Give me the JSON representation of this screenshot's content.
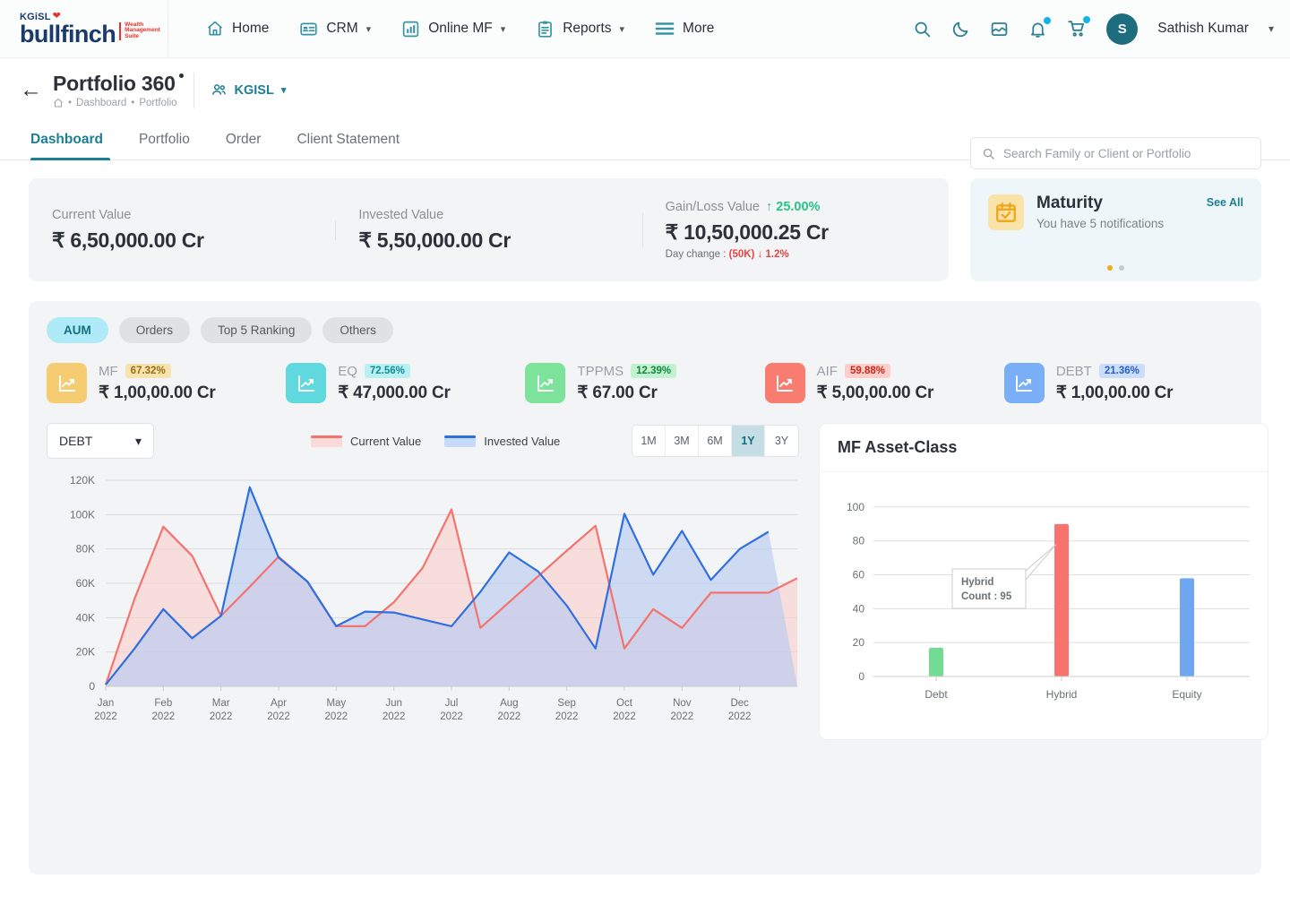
{
  "brand": {
    "kgisl": "KGiSL",
    "name": "bullfinch",
    "tag1": "Wealth",
    "tag2": "Management",
    "tag3": "Suite"
  },
  "topnav": {
    "items": [
      {
        "label": "Home",
        "icon": "home-icon",
        "caret": false
      },
      {
        "label": "CRM",
        "icon": "crm-card-icon",
        "caret": true
      },
      {
        "label": "Online MF",
        "icon": "bar-chart-icon",
        "caret": true
      },
      {
        "label": "Reports",
        "icon": "clipboard-icon",
        "caret": true
      },
      {
        "label": "More",
        "icon": "hamburger-icon",
        "caret": false
      }
    ],
    "icons": [
      "search-icon",
      "moon-icon",
      "inbox-icon",
      "bell-icon",
      "cart-icon"
    ],
    "user": {
      "initial": "S",
      "name": "Sathish Kumar"
    }
  },
  "pagehead": {
    "back": "←",
    "title": "Portfolio 360",
    "breadcrumb": [
      "Dashboard",
      "Portfolio"
    ],
    "org": "KGISL"
  },
  "search": {
    "placeholder": "Search Family or Client or Portfolio",
    "value": ""
  },
  "tabs": [
    {
      "label": "Dashboard",
      "active": true
    },
    {
      "label": "Portfolio",
      "active": false
    },
    {
      "label": "Order",
      "active": false
    },
    {
      "label": "Client Statement",
      "active": false
    }
  ],
  "summary": {
    "current": {
      "label": "Current Value",
      "value": "₹ 6,50,000.00 Cr"
    },
    "invested": {
      "label": "Invested Value",
      "value": "₹ 5,50,000.00 Cr"
    },
    "gainloss": {
      "label": "Gain/Loss Value",
      "pct": "↑ 25.00%",
      "value": "₹ 10,50,000.25 Cr",
      "daychange_label": "Day change :",
      "daychange_value": "(50K)",
      "daychange_pct": "↓ 1.2%"
    }
  },
  "maturity": {
    "title": "Maturity",
    "subtitle": "You have 5 notifications",
    "see_all": "See All",
    "icon": "calendar-check-icon",
    "dots": 2,
    "active_dot": 0
  },
  "chips": [
    {
      "label": "AUM",
      "active": true
    },
    {
      "label": "Orders",
      "active": false
    },
    {
      "label": "Top 5 Ranking",
      "active": false
    },
    {
      "label": "Others",
      "active": false
    }
  ],
  "metrics": [
    {
      "name": "MF",
      "pct": "67.32%",
      "value": "₹ 1,00,00.00 Cr",
      "tile": "#f6cc73",
      "pct_bg": "#f7e3b0",
      "pct_fg": "#9a6f0d"
    },
    {
      "name": "EQ",
      "pct": "72.56%",
      "value": "₹ 47,000.00 Cr",
      "tile": "#5fd9dd",
      "pct_bg": "#b9f1f3",
      "pct_fg": "#0f8e96"
    },
    {
      "name": "TPPMS",
      "pct": "12.39%",
      "value": "₹ 67.00 Cr",
      "tile": "#7ee39a",
      "pct_bg": "#c3f2d1",
      "pct_fg": "#0f8a3c"
    },
    {
      "name": "AIF",
      "pct": "59.88%",
      "value": "₹ 5,00,00.00 Cr",
      "tile": "#f97c70",
      "pct_bg": "#fccfcb",
      "pct_fg": "#cc2418"
    },
    {
      "name": "DEBT",
      "pct": "21.36%",
      "value": "₹ 1,00,00.00 Cr",
      "tile": "#7aaef7",
      "pct_bg": "#ccddfb",
      "pct_fg": "#2460c4"
    }
  ],
  "chart_controls": {
    "select_value": "DEBT",
    "legend": [
      {
        "label": "Current Value",
        "color": "#f4736f"
      },
      {
        "label": "Invested Value",
        "color": "#2f6fe0"
      }
    ],
    "ranges": [
      {
        "label": "1M",
        "active": false
      },
      {
        "label": "3M",
        "active": false
      },
      {
        "label": "6M",
        "active": false
      },
      {
        "label": "1Y",
        "active": true
      },
      {
        "label": "3Y",
        "active": false
      }
    ]
  },
  "chart_data": [
    {
      "type": "area",
      "title": "",
      "xlabel": "",
      "ylabel": "",
      "ylim": [
        0,
        120000
      ],
      "yticks": [
        0,
        20000,
        40000,
        60000,
        80000,
        100000,
        120000
      ],
      "yticklabels": [
        "0",
        "20K",
        "40K",
        "60K",
        "80K",
        "100K",
        "120K"
      ],
      "grid": true,
      "legend_position": "top-center",
      "categories": [
        "Jan 2022",
        "Feb 2022",
        "Mar 2022",
        "Apr 2022",
        "May 2022",
        "Jun 2022",
        "Jul 2022",
        "Aug 2022",
        "Sep 2022",
        "Oct 2022",
        "Nov 2022",
        "Dec 2022"
      ],
      "x_points": [
        "Jan 2022",
        "Jan-mid",
        "Feb 2022",
        "Feb-mid",
        "Mar 2022",
        "Mar-mid",
        "Apr 2022",
        "Apr-mid",
        "May 2022",
        "May-mid",
        "Jun 2022",
        "Jun-mid",
        "Jul 2022",
        "Jul-mid",
        "Aug 2022",
        "Aug-mid",
        "Sep 2022",
        "Sep-mid",
        "Oct 2022",
        "Oct-mid",
        "Nov 2022",
        "Nov-mid",
        "Dec 2022",
        "Dec-end"
      ],
      "series": [
        {
          "name": "Current Value",
          "color": "#f4736f",
          "fill": "#f8cfcd",
          "values": [
            1000,
            51000,
            93000,
            76000,
            41000,
            58000,
            75500,
            61000,
            35000,
            35000,
            49000,
            69000,
            103000,
            34000,
            49000,
            64000,
            79000,
            93500,
            22000,
            45000,
            34000,
            54500,
            54500,
            54500,
            63000
          ]
        },
        {
          "name": "Invested Value",
          "color": "#2f6fe0",
          "fill": "#b4caf0",
          "values": [
            1000,
            22000,
            45000,
            28000,
            41000,
            116000,
            75000,
            61000,
            35000,
            43500,
            43000,
            39000,
            35000,
            55000,
            78000,
            67000,
            47000,
            22000,
            100500,
            65000,
            90500,
            62000,
            80000,
            90000
          ]
        }
      ]
    },
    {
      "type": "bar",
      "title": "MF Asset-Class",
      "categories": [
        "Debt",
        "Hybrid",
        "Equity"
      ],
      "values": [
        17,
        90,
        58
      ],
      "colors": [
        "#72dd92",
        "#f8726e",
        "#6fa6f2"
      ],
      "xlabel": "",
      "ylabel": "",
      "ylim": [
        0,
        110
      ],
      "yticks": [
        0,
        20,
        40,
        60,
        80,
        100
      ],
      "grid": true,
      "tooltip": {
        "label": "Hybrid",
        "text": "Count : 95",
        "series": "Hybrid",
        "value": 95
      }
    }
  ]
}
